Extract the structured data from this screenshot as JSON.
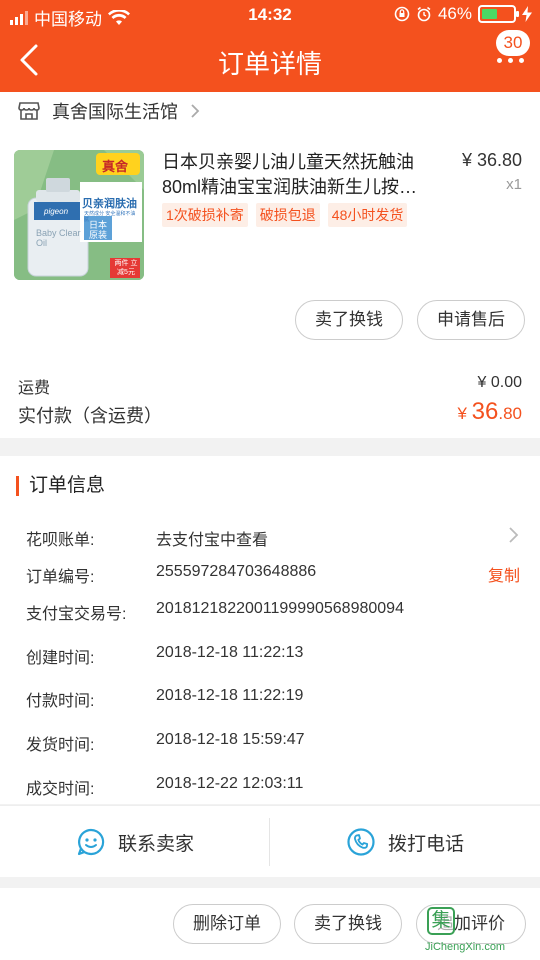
{
  "status_bar": {
    "carrier": "中国移动",
    "time": "14:32",
    "battery_percent": "46%"
  },
  "nav": {
    "title": "订单详情",
    "badge_count": "30"
  },
  "store": {
    "name": "真舍国际生活馆"
  },
  "product": {
    "title": "日本贝亲婴儿油儿童天然抚触油80ml精油宝宝润肤油新生儿按…",
    "price": "¥ 36.80",
    "quantity": "x1",
    "tags": [
      "1次破损补寄",
      "破损包退",
      "48小时发货"
    ],
    "image_text": {
      "store_badge": "真舍",
      "brand": "pigeon",
      "name_cn": "贝亲润肤油",
      "name_en": "Baby Clear Oil",
      "origin": "日本原装",
      "note": "天然成分 安全温和不油腻",
      "offer": "两件 立减5元"
    }
  },
  "product_actions": {
    "resell": "卖了换钱",
    "after_sale": "申请售后"
  },
  "summary": {
    "shipping_label": "运费",
    "shipping_value": "¥ 0.00",
    "paid_label": "实付款（含运费）",
    "paid_currency": "¥ ",
    "paid_int": "36",
    "paid_dec": ".80"
  },
  "order_info": {
    "title": "订单信息",
    "rows": [
      {
        "label": "花呗账单:",
        "value": "去支付宝中查看"
      },
      {
        "label": "订单编号:",
        "value": "255597284703648886"
      },
      {
        "label": "支付宝交易号:",
        "value": "2018121822001199990568980094"
      },
      {
        "label": "创建时间:",
        "value": "2018-12-18 11:22:13"
      },
      {
        "label": "付款时间:",
        "value": "2018-12-18 11:22:19"
      },
      {
        "label": "发货时间:",
        "value": "2018-12-18 15:59:47"
      },
      {
        "label": "成交时间:",
        "value": "2018-12-22 12:03:11"
      }
    ],
    "copy_label": "复制"
  },
  "contact": {
    "seller": "联系卖家",
    "phone": "拨打电话"
  },
  "bottom_actions": {
    "delete": "删除订单",
    "resell": "卖了换钱",
    "review": "追加评价"
  },
  "watermark": {
    "logo_char": "集",
    "text": "JiChengXin.com"
  },
  "colors": {
    "brand": "#f4511e",
    "background": "#f2f2f2"
  }
}
